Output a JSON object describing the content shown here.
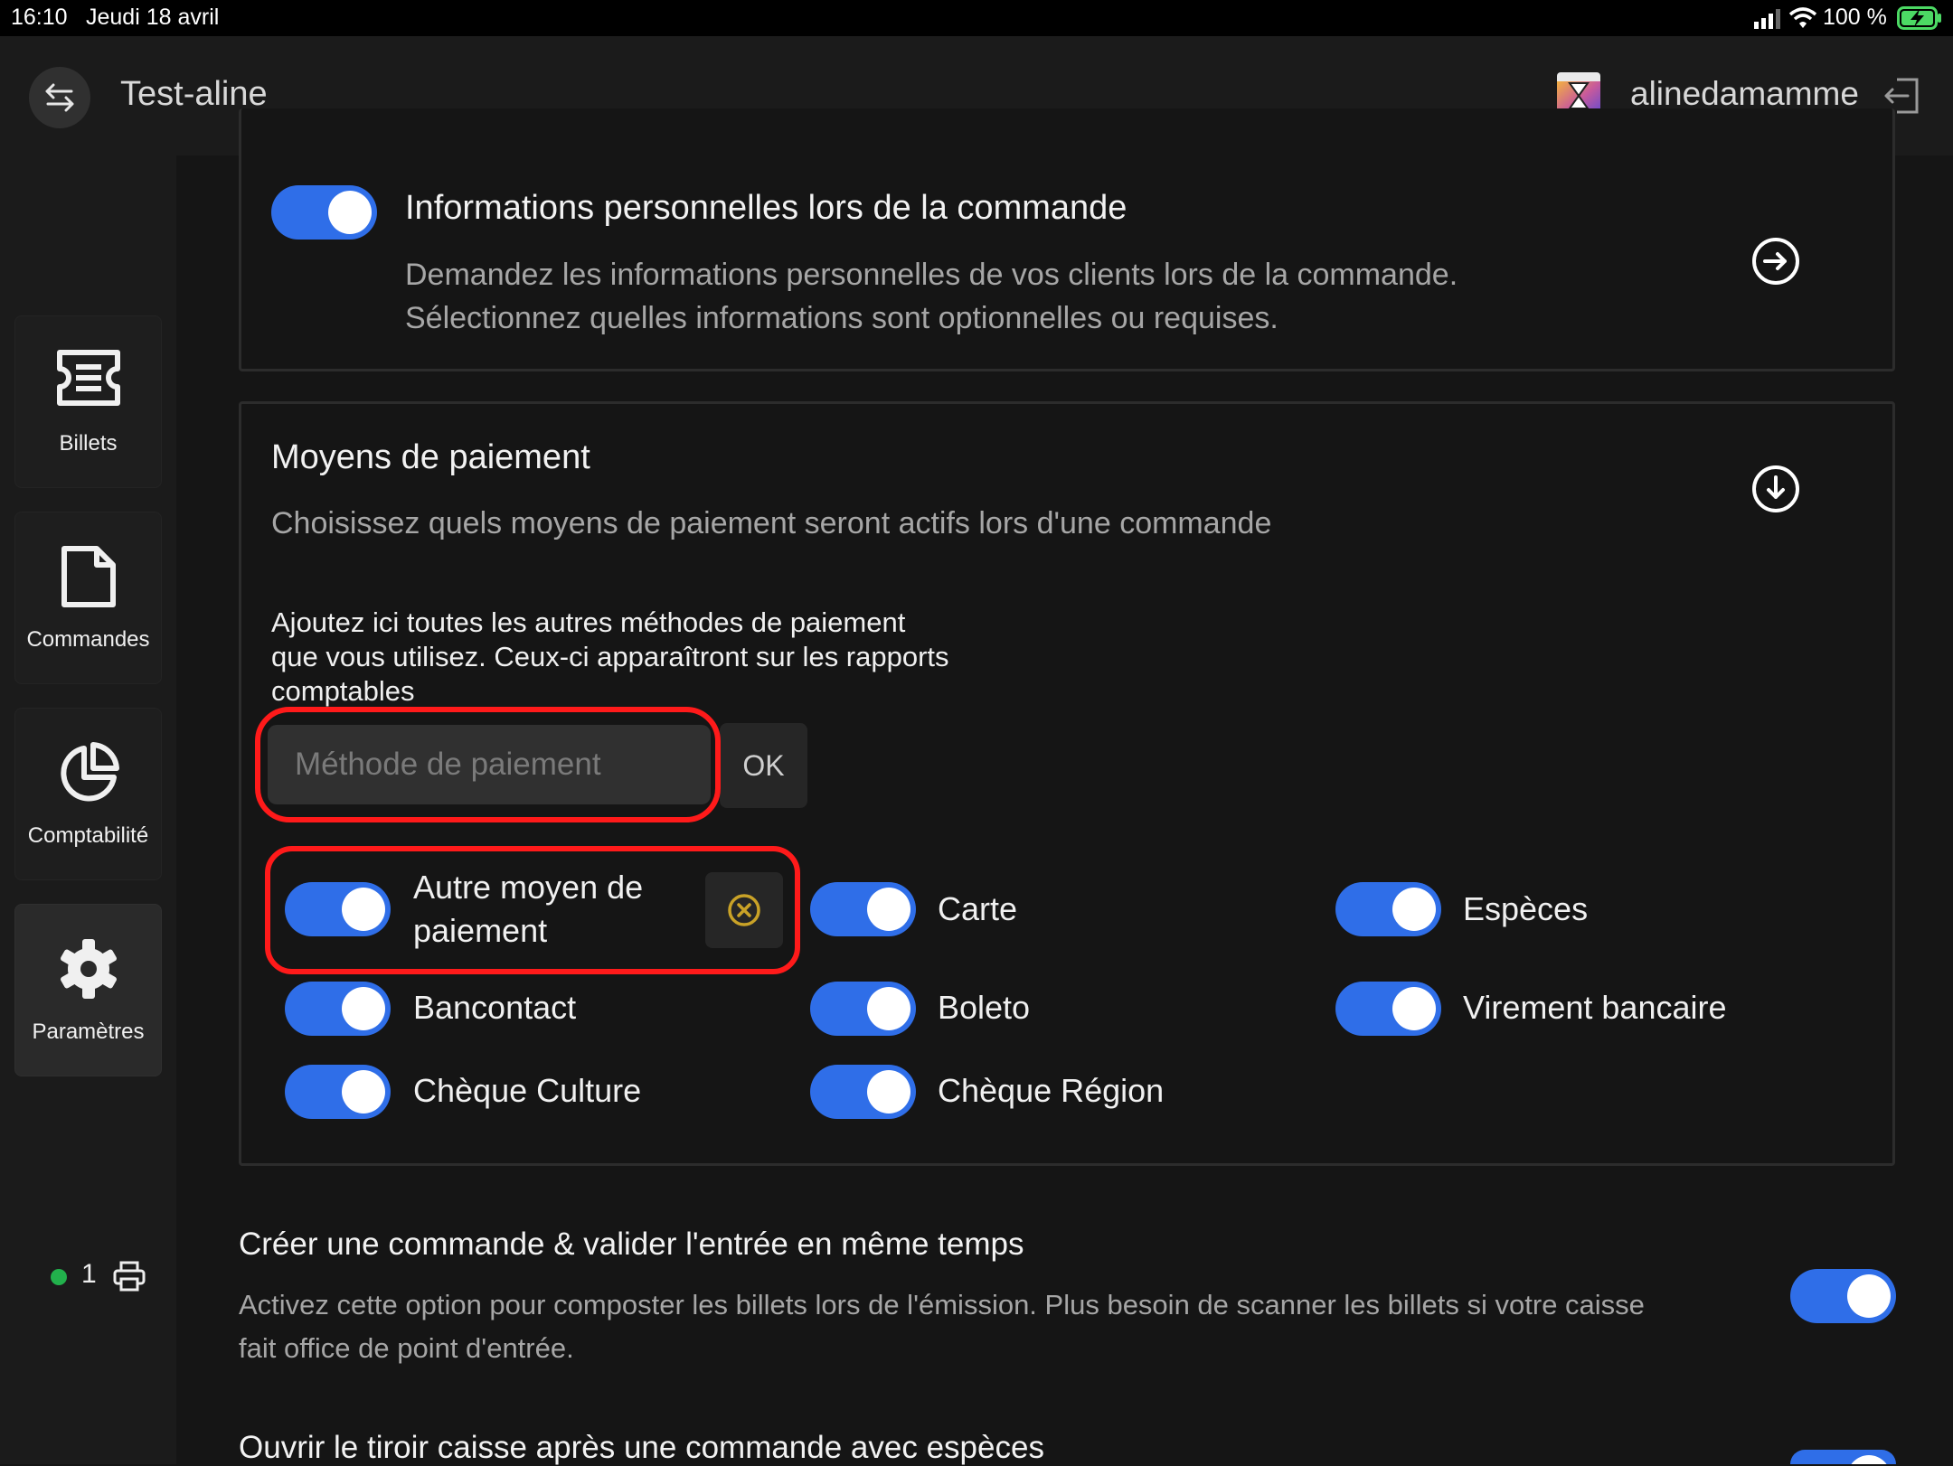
{
  "status_bar": {
    "time": "16:10",
    "date": "Jeudi 18 avril",
    "battery": "100 %"
  },
  "header": {
    "event_name": "Test-aline",
    "username": "alinedamamme"
  },
  "sidebar": {
    "items": [
      {
        "label": "Billets",
        "icon": "ticket-icon",
        "active": false
      },
      {
        "label": "Commandes",
        "icon": "document-icon",
        "active": false
      },
      {
        "label": "Comptabilité",
        "icon": "pie-chart-icon",
        "active": false
      },
      {
        "label": "Paramètres",
        "icon": "gear-icon",
        "active": true
      }
    ],
    "printer_count": "1"
  },
  "personal_info": {
    "title": "Informations personnelles lors de la commande",
    "desc_line1": "Demandez les informations personnelles de vos clients lors de la commande.",
    "desc_line2": "Sélectionnez quelles informations sont optionnelles ou requises.",
    "enabled": true
  },
  "payment": {
    "title": "Moyens de paiement",
    "description": "Choisissez quels moyens de paiement seront actifs lors d'une commande",
    "help_line1": "Ajoutez ici toutes les autres méthodes de paiement",
    "help_line2": "que vous utilisez. Ceux-ci apparaîtront sur les rapports",
    "help_line3": "comptables",
    "input_placeholder": "Méthode de paiement",
    "input_value": "",
    "ok_label": "OK",
    "methods": [
      {
        "line1": "Autre moyen de",
        "line2": "paiement",
        "enabled": true,
        "custom": true
      },
      {
        "label": "Carte",
        "enabled": true
      },
      {
        "label": "Espèces",
        "enabled": true
      },
      {
        "label": "Bancontact",
        "enabled": true
      },
      {
        "label": "Boleto",
        "enabled": true
      },
      {
        "label": "Virement bancaire",
        "enabled": true
      },
      {
        "label": "Chèque Culture",
        "enabled": true
      },
      {
        "label": "Chèque Région",
        "enabled": true
      }
    ]
  },
  "auto_validate": {
    "title": "Créer une commande & valider l'entrée en même temps",
    "desc_line1": "Activez cette option pour composter les billets lors de l'émission. Plus besoin de scanner les billets si votre caisse",
    "desc_line2": "fait office de point d'entrée.",
    "enabled": true
  },
  "cash_drawer": {
    "title": "Ouvrir le tiroir caisse après une commande avec espèces",
    "enabled": true
  },
  "colors": {
    "accent": "#2f6ee8",
    "highlight": "#ff1a1a",
    "background": "#151515",
    "remove_icon": "#c9a227"
  }
}
